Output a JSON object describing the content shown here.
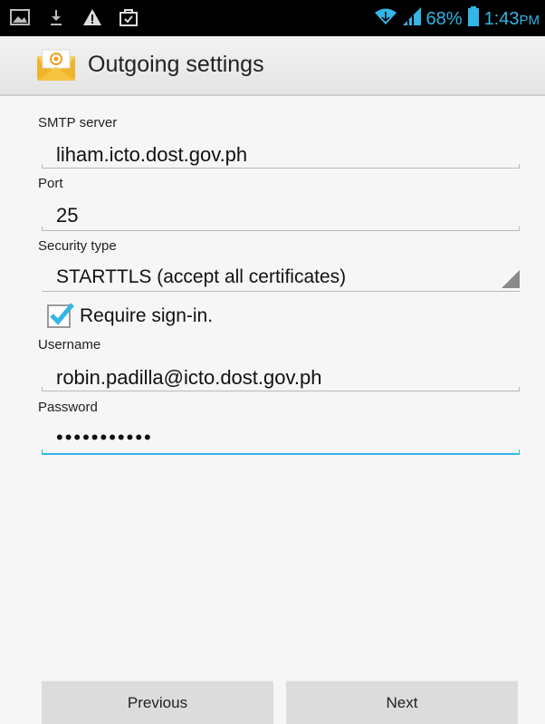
{
  "status_bar": {
    "icons_left": [
      "picture-icon",
      "download-icon",
      "warning-icon",
      "bag-icon"
    ],
    "battery_percent": "68%",
    "time": "1:43",
    "time_suffix": "PM",
    "accent_color": "#33b5e5"
  },
  "action_bar": {
    "title": "Outgoing settings",
    "icon": "email-app-icon"
  },
  "form": {
    "smtp_label": "SMTP server",
    "smtp_value": "liham.icto.dost.gov.ph",
    "port_label": "Port",
    "port_value": "25",
    "security_label": "Security type",
    "security_value": "STARTTLS (accept all certificates)",
    "require_signin_label": "Require sign-in.",
    "require_signin_checked": true,
    "username_label": "Username",
    "username_value": "robin.padilla@icto.dost.gov.ph",
    "password_label": "Password",
    "password_value": "•••••••••••"
  },
  "buttons": {
    "previous": "Previous",
    "next": "Next"
  }
}
